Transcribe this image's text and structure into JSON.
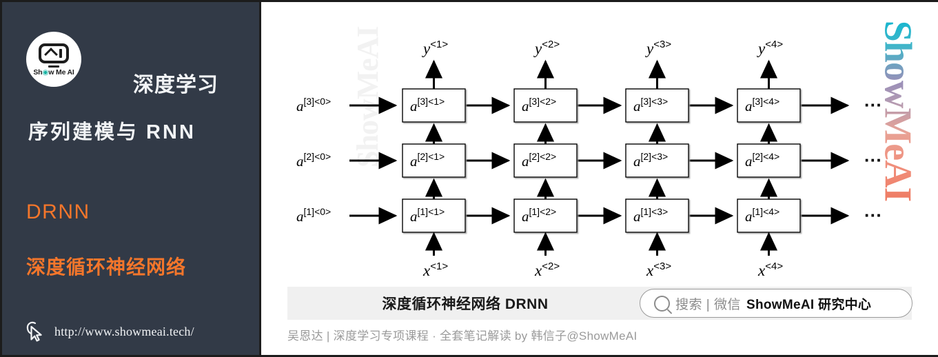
{
  "sidebar": {
    "logo": {
      "icon_name": "show-me-ai-robot-logo",
      "wordmark_pre": "Sh",
      "wordmark_dot": "◉",
      "wordmark_post": "w Me AI"
    },
    "course_title": "深度学习",
    "section_title": "序列建模与 RNN",
    "topic_tag": "DRNN",
    "topic_name": "深度循环神经网络",
    "url": "http://www.showmeai.tech/",
    "colors": {
      "background": "#323a47",
      "accent": "#f4762b",
      "text": "#f2f4f6"
    }
  },
  "diagram": {
    "watermark_left": "ShowMeAI",
    "watermark_right": "ShowMeAI",
    "outputs": [
      "y<1>",
      "y<2>",
      "y<3>",
      "y<4>"
    ],
    "inputs": [
      "x<1>",
      "x<2>",
      "x<3>",
      "x<4>"
    ],
    "initial_states": [
      "a[3]<0>",
      "a[2]<0>",
      "a[1]<0>"
    ],
    "ellipsis": "···",
    "layers": [
      {
        "layer": 3,
        "cells": [
          "a[3]<1>",
          "a[3]<2>",
          "a[3]<3>",
          "a[3]<4>"
        ]
      },
      {
        "layer": 2,
        "cells": [
          "a[2]<1>",
          "a[2]<2>",
          "a[2]<3>",
          "a[2]<4>"
        ]
      },
      {
        "layer": 1,
        "cells": [
          "a[1]<1>",
          "a[1]<2>",
          "a[1]<3>",
          "a[1]<4>"
        ]
      }
    ]
  },
  "caption": {
    "title": "深度循环神经网络 DRNN",
    "search_icon": "search-icon",
    "search_gray": "搜索 | 微信",
    "search_bold": "ShowMeAI 研究中心"
  },
  "attribution": "吴恩达 | 深度学习专项课程 · 全套笔记解读  by 韩信子@ShowMeAI"
}
